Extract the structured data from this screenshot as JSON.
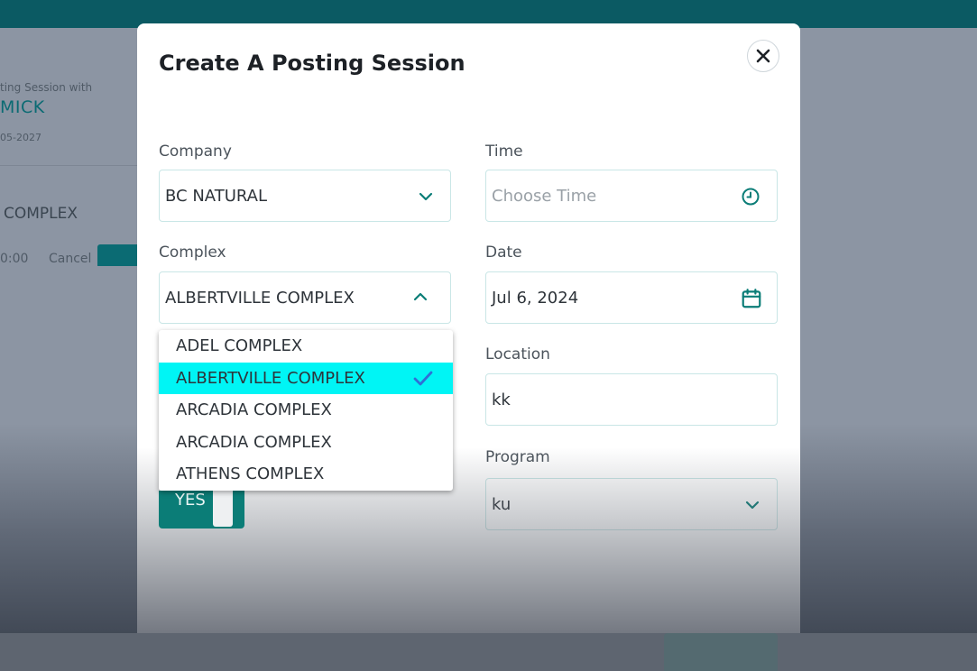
{
  "background": {
    "session_caption": "ting Session with",
    "user_name": "MICK",
    "date_fragment": "05-2027",
    "complex_label": "COMPLEX",
    "row_time": "0:00",
    "row_cancel": "Cancel"
  },
  "modal": {
    "title": "Create A Posting Session",
    "close_icon": "close-icon",
    "company": {
      "label": "Company",
      "value": "BC NATURAL",
      "icon": "chevron-down-icon"
    },
    "time": {
      "label": "Time",
      "placeholder": "Choose Time",
      "icon": "clock-icon"
    },
    "complex": {
      "label": "Complex",
      "value": "ALBERTVILLE COMPLEX",
      "icon": "chevron-up-icon",
      "options": [
        {
          "label": "ADEL COMPLEX",
          "selected": false
        },
        {
          "label": "ALBERTVILLE COMPLEX",
          "selected": true
        },
        {
          "label": "ARCADIA COMPLEX",
          "selected": false
        },
        {
          "label": "ARCADIA COMPLEX",
          "selected": false
        },
        {
          "label": "ATHENS COMPLEX",
          "selected": false
        }
      ]
    },
    "date": {
      "label": "Date",
      "value": "Jul 6, 2024",
      "icon": "calendar-icon"
    },
    "location": {
      "label": "Location",
      "value": "kk"
    },
    "program": {
      "label": "Program",
      "value": "ku",
      "icon": "chevron-down-icon"
    },
    "toggle": {
      "label": "YES"
    }
  },
  "colors": {
    "accent": "#0b7d77",
    "topbar": "#0b5a63",
    "selected_option": "#00f5f5",
    "check": "#2f6fd6"
  }
}
